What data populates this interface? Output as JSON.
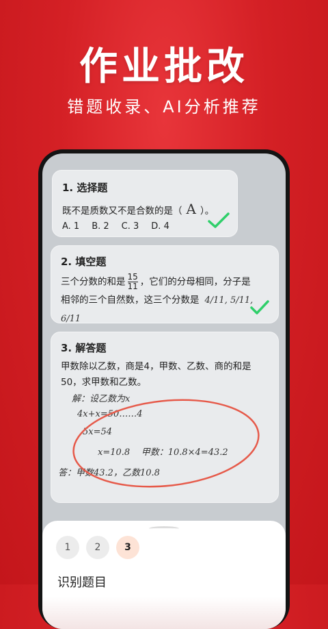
{
  "hero": {
    "title": "作业批改",
    "subtitle": "错题收录、AI分析推荐"
  },
  "colors": {
    "accent": "#d42025",
    "check": "#2fcf6a",
    "circle": "#e65a4a"
  },
  "cards": [
    {
      "title": "1. 选择题",
      "question": "既不是质数又不是合数的是（",
      "answer": "A",
      "close": "）。",
      "options": [
        "A. 1",
        "B. 2",
        "C. 3",
        "D. 4"
      ]
    },
    {
      "title": "2. 填空题",
      "line1_pre": "三个分数的和是",
      "frac_num": "15",
      "frac_den": "11",
      "line1_post": "，它们的分母相同，分子是",
      "line2": "相邻的三个自然数，这三个分数是",
      "hand_answer": "4/11, 5/11, 6/11"
    },
    {
      "title": "3. 解答题",
      "question": "甲数除以乙数，商是4，甲数、乙数、商的和是50，求甲数和乙数。",
      "work": [
        "解：设乙数为x",
        "4x+x=50……4",
        "5x=54",
        "x=10.8    甲数：10.8×4=43.2",
        "答：甲数43.2，乙数10.8"
      ]
    }
  ],
  "sheet": {
    "steps": [
      "1",
      "2",
      "3"
    ],
    "active_step": 3,
    "title": "识别题目"
  }
}
